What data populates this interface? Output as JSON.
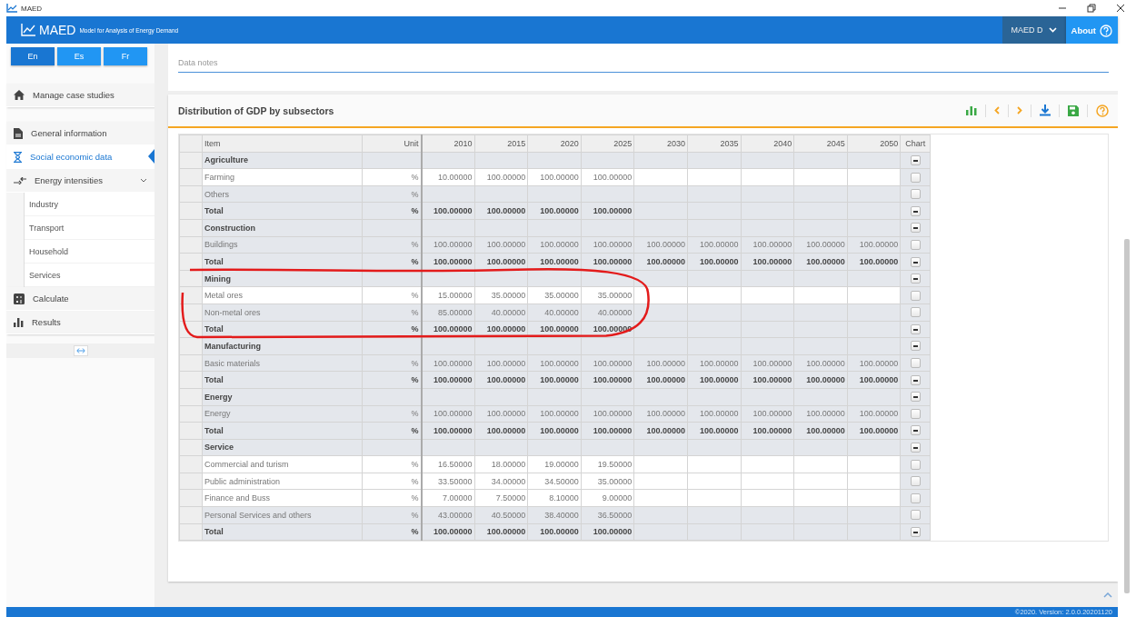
{
  "window": {
    "title": "MAED"
  },
  "header": {
    "logo": "MAED",
    "subtitle": "Model for Analysis of Energy Demand",
    "case_menu": "MAED D",
    "about": "About"
  },
  "languages": [
    {
      "label": "En",
      "selected": true
    },
    {
      "label": "Es",
      "selected": false
    },
    {
      "label": "Fr",
      "selected": false
    }
  ],
  "sidebar": {
    "items": [
      {
        "label": "Manage case studies",
        "selected": false
      },
      {
        "label": "General information",
        "selected": false
      },
      {
        "label": "Social economic data",
        "selected": true
      },
      {
        "label": "Energy intensities",
        "selected": false,
        "expanded": true,
        "children": [
          {
            "label": "Industry"
          },
          {
            "label": "Transport"
          },
          {
            "label": "Household"
          },
          {
            "label": "Services"
          }
        ]
      },
      {
        "label": "Calculate",
        "selected": false
      },
      {
        "label": "Results",
        "selected": false
      }
    ]
  },
  "notes": {
    "placeholder": "Data notes"
  },
  "table": {
    "title": "Distribution of GDP by subsectors",
    "columns": [
      "Item",
      "Unit",
      "2010",
      "2015",
      "2020",
      "2025",
      "2030",
      "2035",
      "2040",
      "2045",
      "2050",
      "Chart"
    ],
    "rows": [
      {
        "kind": "group",
        "item": "Agriculture",
        "editable": false,
        "chart_checked": true
      },
      {
        "kind": "item",
        "item": "Farming",
        "unit": "%",
        "values": [
          "10.00000",
          "100.00000",
          "100.00000",
          "100.00000"
        ],
        "editable": true,
        "chart_checked": false
      },
      {
        "kind": "item",
        "item": "Others",
        "unit": "%",
        "editable": false,
        "chart_checked": false
      },
      {
        "kind": "total",
        "item": "Total",
        "unit": "%",
        "values": [
          "100.00000",
          "100.00000",
          "100.00000",
          "100.00000"
        ],
        "editable": false,
        "chart_checked": true
      },
      {
        "kind": "group",
        "item": "Construction",
        "editable": false,
        "chart_checked": true
      },
      {
        "kind": "item",
        "item": "Buildings",
        "unit": "%",
        "values": [
          "100.00000",
          "100.00000",
          "100.00000",
          "100.00000",
          "100.00000",
          "100.00000",
          "100.00000",
          "100.00000",
          "100.00000"
        ],
        "editable": false,
        "chart_checked": false
      },
      {
        "kind": "total",
        "item": "Total",
        "unit": "%",
        "values": [
          "100.00000",
          "100.00000",
          "100.00000",
          "100.00000",
          "100.00000",
          "100.00000",
          "100.00000",
          "100.00000",
          "100.00000"
        ],
        "editable": false,
        "chart_checked": true
      },
      {
        "kind": "group",
        "item": "Mining",
        "editable": false,
        "chart_checked": true
      },
      {
        "kind": "item",
        "item": "Metal ores",
        "unit": "%",
        "values": [
          "15.00000",
          "35.00000",
          "35.00000",
          "35.00000"
        ],
        "editable": true,
        "chart_checked": false
      },
      {
        "kind": "item",
        "item": "Non-metal ores",
        "unit": "%",
        "values": [
          "85.00000",
          "40.00000",
          "40.00000",
          "40.00000"
        ],
        "editable": false,
        "chart_checked": false
      },
      {
        "kind": "total",
        "item": "Total",
        "unit": "%",
        "values": [
          "100.00000",
          "100.00000",
          "100.00000",
          "100.00000"
        ],
        "editable": false,
        "chart_checked": true
      },
      {
        "kind": "group",
        "item": "Manufacturing",
        "editable": false,
        "chart_checked": true
      },
      {
        "kind": "item",
        "item": "Basic materials",
        "unit": "%",
        "values": [
          "100.00000",
          "100.00000",
          "100.00000",
          "100.00000",
          "100.00000",
          "100.00000",
          "100.00000",
          "100.00000",
          "100.00000"
        ],
        "editable": false,
        "chart_checked": false
      },
      {
        "kind": "total",
        "item": "Total",
        "unit": "%",
        "values": [
          "100.00000",
          "100.00000",
          "100.00000",
          "100.00000",
          "100.00000",
          "100.00000",
          "100.00000",
          "100.00000",
          "100.00000"
        ],
        "editable": false,
        "chart_checked": true
      },
      {
        "kind": "group",
        "item": "Energy",
        "editable": false,
        "chart_checked": true
      },
      {
        "kind": "item",
        "item": "Energy",
        "unit": "%",
        "values": [
          "100.00000",
          "100.00000",
          "100.00000",
          "100.00000",
          "100.00000",
          "100.00000",
          "100.00000",
          "100.00000",
          "100.00000"
        ],
        "editable": false,
        "chart_checked": false
      },
      {
        "kind": "total",
        "item": "Total",
        "unit": "%",
        "values": [
          "100.00000",
          "100.00000",
          "100.00000",
          "100.00000",
          "100.00000",
          "100.00000",
          "100.00000",
          "100.00000",
          "100.00000"
        ],
        "editable": false,
        "chart_checked": true
      },
      {
        "kind": "group",
        "item": "Service",
        "editable": false,
        "chart_checked": true
      },
      {
        "kind": "item",
        "item": "Commercial and turism",
        "unit": "%",
        "values": [
          "16.50000",
          "18.00000",
          "19.00000",
          "19.50000"
        ],
        "editable": true,
        "chart_checked": false
      },
      {
        "kind": "item",
        "item": "Public administration",
        "unit": "%",
        "values": [
          "33.50000",
          "34.00000",
          "34.50000",
          "35.00000"
        ],
        "editable": true,
        "chart_checked": false
      },
      {
        "kind": "item",
        "item": "Finance and Buss",
        "unit": "%",
        "values": [
          "7.00000",
          "7.50000",
          "8.10000",
          "9.00000"
        ],
        "editable": true,
        "chart_checked": false
      },
      {
        "kind": "item",
        "item": "Personal Services and others",
        "unit": "%",
        "values": [
          "43.00000",
          "40.50000",
          "38.40000",
          "36.50000"
        ],
        "editable": false,
        "chart_checked": false
      },
      {
        "kind": "total",
        "item": "Total",
        "unit": "%",
        "values": [
          "100.00000",
          "100.00000",
          "100.00000",
          "100.00000"
        ],
        "editable": false,
        "chart_checked": true
      }
    ]
  },
  "annotation": {
    "kind": "ellipse"
  },
  "footer": {
    "version": "©2020. Version: 2.0.0.20201120"
  }
}
